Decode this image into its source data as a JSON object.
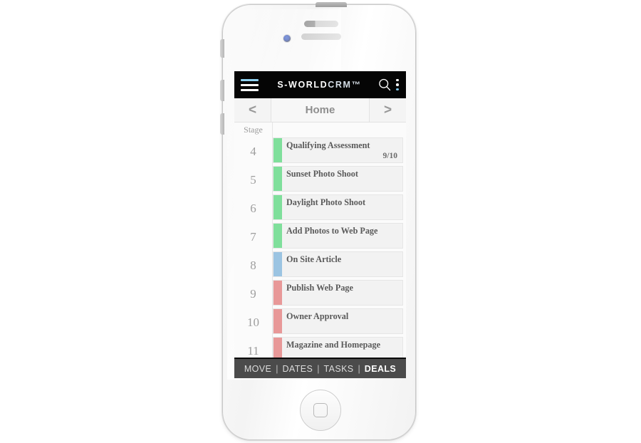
{
  "device": {
    "name": "white-smartphone",
    "camera_color": "#1a3ba8",
    "body_color": "#f7f7f7"
  },
  "appbar": {
    "menu_icon": "hamburger-menu-icon",
    "title_main": "S-WORLD",
    "title_suffix": "CRM™",
    "search_icon": "search-icon",
    "overflow_icon": "kebab-menu-icon",
    "background": "#050505",
    "accent": "#8fd0ef"
  },
  "navbar": {
    "prev_label": "<",
    "title": "Home",
    "next_label": ">"
  },
  "board": {
    "stage_header": "Stage",
    "rows": [
      {
        "stage": "4",
        "label": "Qualifying  Assessment",
        "meta": "9/10",
        "accent": "#7fdf9b"
      },
      {
        "stage": "5",
        "label": "Sunset Photo Shoot",
        "meta": "",
        "accent": "#7fdf9b"
      },
      {
        "stage": "6",
        "label": "Daylight Photo Shoot",
        "meta": "",
        "accent": "#7fdf9b"
      },
      {
        "stage": "7",
        "label": "Add Photos to Web Page",
        "meta": "",
        "accent": "#7fdf9b"
      },
      {
        "stage": "8",
        "label": "On Site Article",
        "meta": "",
        "accent": "#9bc4e2"
      },
      {
        "stage": "9",
        "label": "Publish Web Page",
        "meta": "",
        "accent": "#e89898"
      },
      {
        "stage": "10",
        "label": "Owner Approval",
        "meta": "",
        "accent": "#e89898"
      },
      {
        "stage": "11",
        "label": "Magazine and Homepage",
        "meta": "",
        "accent": "#e89898"
      }
    ]
  },
  "footer": {
    "tabs": [
      {
        "label": "MOVE",
        "active": false
      },
      {
        "label": "DATES",
        "active": false
      },
      {
        "label": "TASKS",
        "active": false
      },
      {
        "label": "DEALS",
        "active": true
      }
    ],
    "separator": "|",
    "background": "#4b4b4b"
  }
}
